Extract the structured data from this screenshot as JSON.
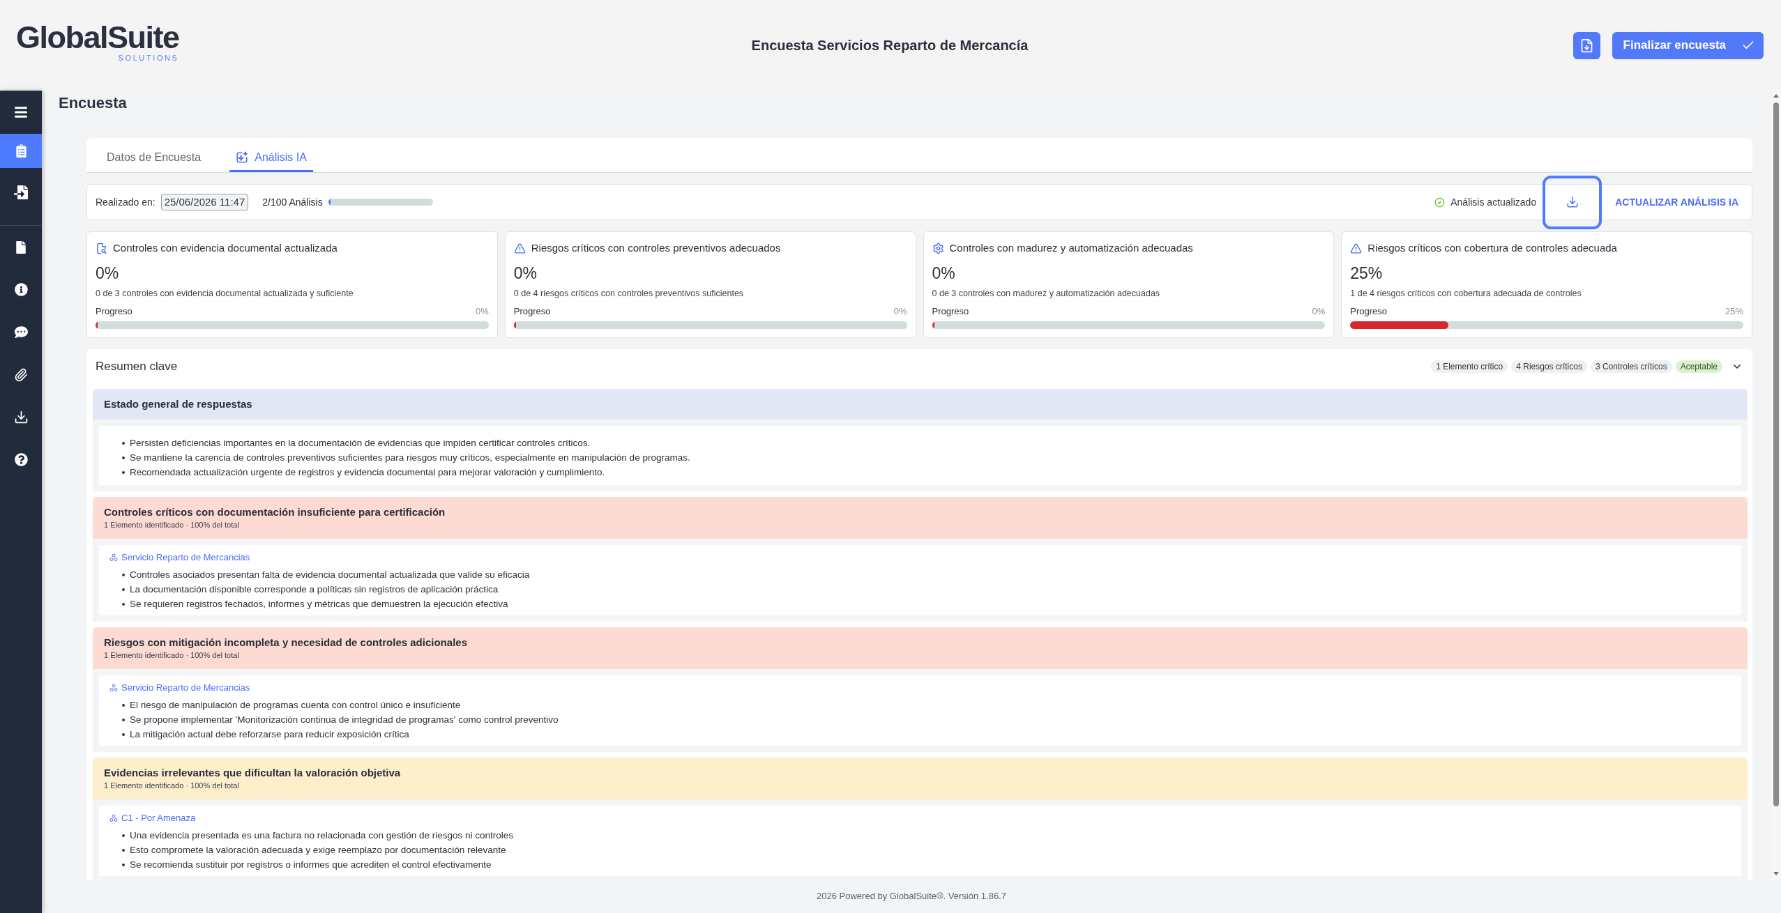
{
  "header": {
    "logo": {
      "wordmark": "GlobalSuite",
      "tagline": "SOLUTIONS"
    },
    "title": "Encuesta Servicios Reparto de Mercancía",
    "finalize_button": "Finalizar encuesta"
  },
  "sidebar": {
    "groups": [
      {
        "items": [
          {
            "selected": true
          },
          {
            "selected": false
          }
        ]
      },
      {
        "items": [
          {
            "selected": false
          },
          {
            "selected": false
          },
          {
            "selected": false
          },
          {
            "selected": false
          },
          {
            "selected": false
          },
          {
            "selected": false
          }
        ]
      }
    ]
  },
  "page": {
    "title": "Encuesta"
  },
  "tabs": [
    {
      "label": "Datos de Encuesta",
      "kind": "plain",
      "selected": false
    },
    {
      "label": "Análisis IA",
      "kind": "ai",
      "selected": true
    }
  ],
  "toolbar": {
    "date_label": "Realizado en:",
    "date_value": "25/06/2026 11:47",
    "usage": {
      "reading": "2/100 Análisis",
      "level": 0.02
    },
    "status": "Análisis actualizado",
    "download": {
      "focused": true
    },
    "refresh_button": "ACTUALIZAR ANÁLISIS IA"
  },
  "metrics": [
    {
      "kind": "document",
      "title": "Controles con evidencia documental actualizada",
      "value": "0%",
      "description": "0 de 3 controles con evidencia documental actualizada y suficiente",
      "progress_label": "Progreso",
      "reading": "0%",
      "level": 0
    },
    {
      "kind": "risk",
      "title": "Riesgos críticos con controles preventivos adecuados",
      "value": "0%",
      "description": "0 de 4 riesgos críticos con controles preventivos suficientes",
      "progress_label": "Progreso",
      "reading": "0%",
      "level": 0
    },
    {
      "kind": "maturity",
      "title": "Controles con madurez y automatización adecuadas",
      "value": "0%",
      "description": "0 de 3 controles con madurez y automatización adecuadas",
      "progress_label": "Progreso",
      "reading": "0%",
      "level": 0
    },
    {
      "kind": "risk",
      "title": "Riesgos críticos con cobertura de controles adecuada",
      "value": "25%",
      "description": "1 de 4 riesgos críticos con cobertura adecuada de controles",
      "progress_label": "Progreso",
      "reading": "25%",
      "level": 0.25
    }
  ],
  "summary": {
    "title": "Resumen clave",
    "badges": [
      {
        "label": "1 Elemento crítico",
        "kind": "count"
      },
      {
        "label": "4 Riesgos críticos",
        "kind": "count"
      },
      {
        "label": "3 Controles críticos",
        "kind": "count"
      },
      {
        "label": "Aceptable",
        "kind": "rating"
      }
    ],
    "expanded": true,
    "sections": [
      {
        "title": "Estado general de respuestas",
        "color": "#e3e7f5",
        "bullets": [
          "Persisten deficiencias importantes en la documentación de evidencias que impiden certificar controles críticos.",
          "Se mantiene la carencia de controles preventivos suficientes para riesgos muy críticos, especialmente en manipulación de programas.",
          "Recomendada actualización urgente de registros y evidencia documental para mejorar valoración y cumplimiento."
        ]
      },
      {
        "title": "Controles críticos con documentación insuficiente para certificación",
        "subtitle": "1 Elemento identificado · 100% del total",
        "color": "#fddbd2",
        "entity": "Servicio Reparto de Mercancias",
        "bullets": [
          "Controles asociados presentan falta de evidencia documental actualizada que valide su eficacia",
          "La documentación disponible corresponde a políticas sin registros de aplicación práctica",
          "Se requieren registros fechados, informes y métricas que demuestren la ejecución efectiva"
        ]
      },
      {
        "title": "Riesgos con mitigación incompleta y necesidad de controles adicionales",
        "subtitle": "1 Elemento identificado · 100% del total",
        "color": "#fddbd2",
        "entity": "Servicio Reparto de Mercancias",
        "bullets": [
          "El riesgo de manipulación de programas cuenta con control único e insuficiente",
          "Se propone implementar 'Monitorización continua de integridad de programas' como control preventivo",
          "La mitigación actual debe reforzarse para reducir exposición crítica"
        ]
      },
      {
        "title": "Evidencias irrelevantes que dificultan la valoración objetiva",
        "subtitle": "1 Elemento identificado · 100% del total",
        "color": "#fdefcc",
        "entity": "C1 - Por Amenaza",
        "bullets": [
          "Una evidencia presentada es una factura no relacionada con gestión de riesgos ni controles",
          "Esto compromete la valoración adecuada y exige reemplazo por documentación relevante",
          "Se recomienda sustituir por registros o informes que acrediten el control efectivamente"
        ]
      }
    ]
  },
  "footer": "2026 Powered by GlobalSuite®. Versión 1.86.7"
}
